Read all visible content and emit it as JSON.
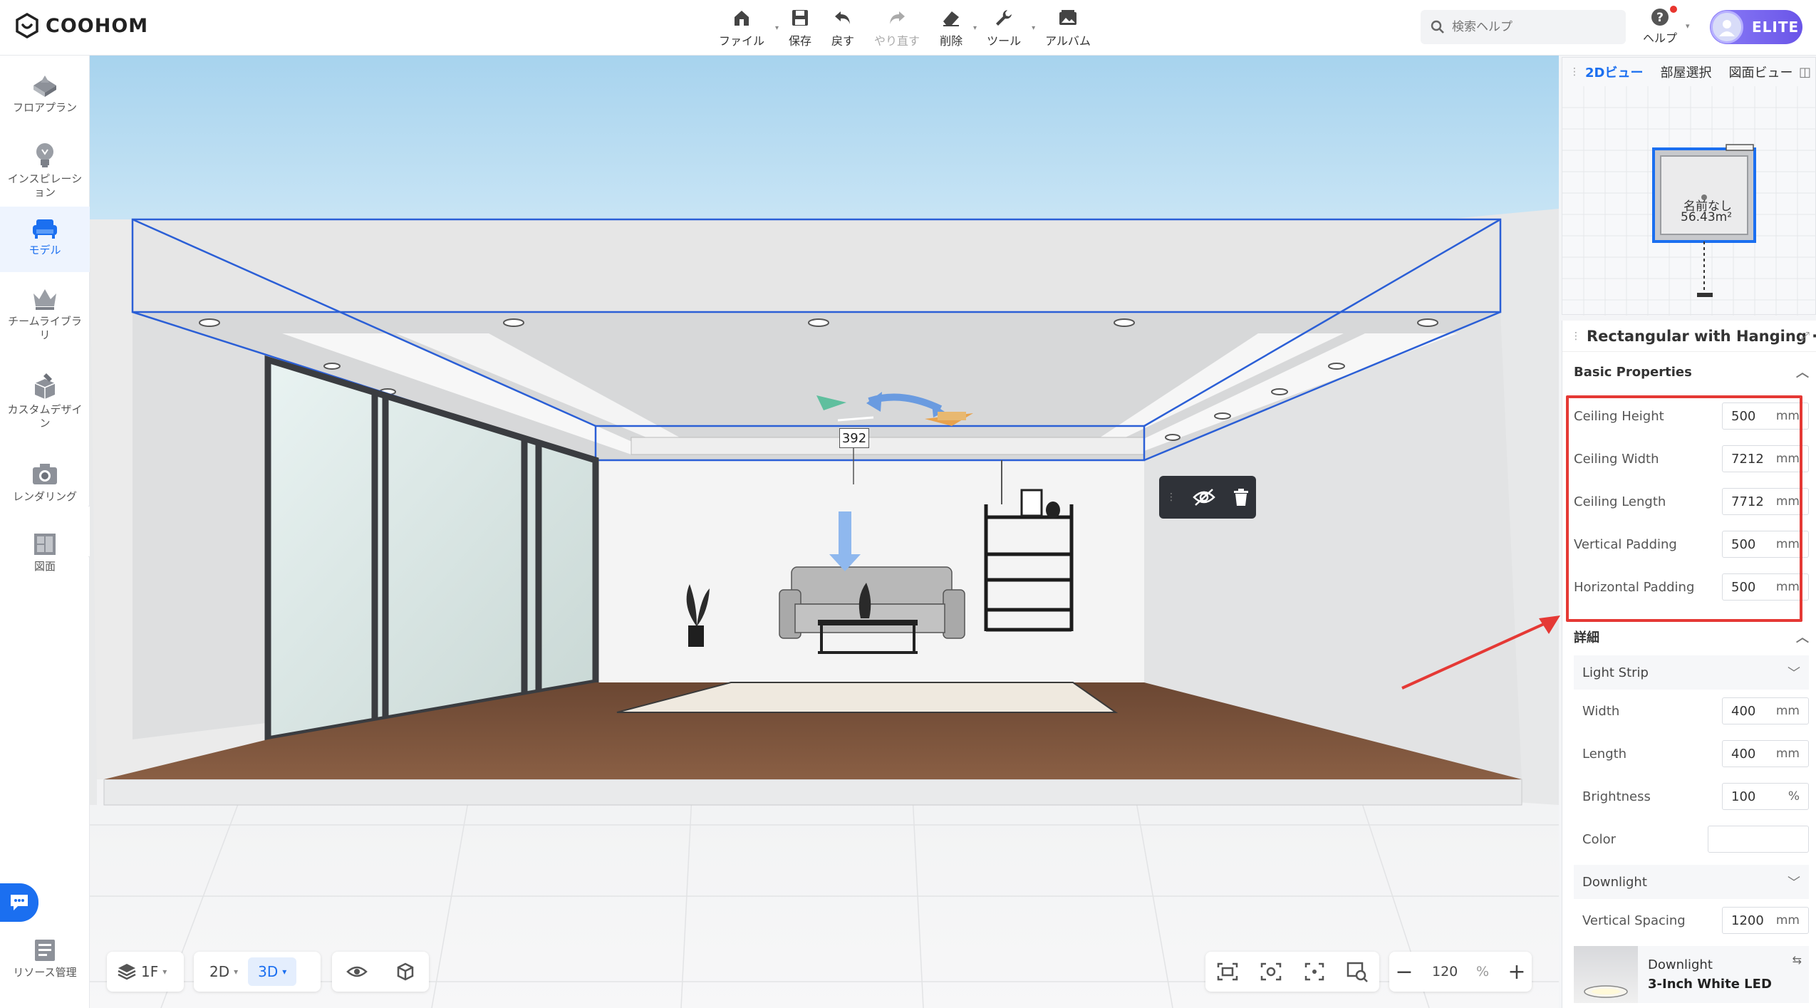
{
  "brand": {
    "name": "COOHOM"
  },
  "toolbar": {
    "file": "ファイル",
    "save": "保存",
    "undo": "戻す",
    "redo": "やり直す",
    "delete": "削除",
    "tools": "ツール",
    "album": "アルバム"
  },
  "search": {
    "placeholder": "検索ヘルプ"
  },
  "help": {
    "label": "ヘルプ"
  },
  "account": {
    "badge": "ELITE"
  },
  "sidebar": {
    "items": [
      {
        "label": "フロアプラン",
        "icon": "floorplan-icon"
      },
      {
        "label": "インスピレーション",
        "icon": "lightbulb-icon"
      },
      {
        "label": "モデル",
        "icon": "sofa-icon",
        "active": true
      },
      {
        "label": "チームライブラリ",
        "icon": "crown-icon"
      },
      {
        "label": "カスタムデザイン",
        "icon": "custom-design-icon"
      },
      {
        "label": "レンダリング",
        "icon": "camera-icon"
      },
      {
        "label": "図面",
        "icon": "drawing-icon"
      }
    ],
    "resource": "リソース管理"
  },
  "viewport": {
    "dimension": "392"
  },
  "bottom": {
    "floor": "1F",
    "view2d": "2D",
    "view3d": "3D",
    "zoom": "120",
    "zoom_unit": "%"
  },
  "minimap": {
    "tabs": [
      "2Dビュー",
      "部屋選択",
      "図面ビュー"
    ],
    "room_name": "名前なし",
    "room_area": "56.43m²"
  },
  "panel": {
    "title": "Rectangular with Hanging ···",
    "basic_section": "Basic Properties",
    "basic": [
      {
        "label": "Ceiling Height",
        "value": "500",
        "unit": "mm"
      },
      {
        "label": "Ceiling Width",
        "value": "7212",
        "unit": "mm"
      },
      {
        "label": "Ceiling Length",
        "value": "7712",
        "unit": "mm"
      },
      {
        "label": "Vertical Padding",
        "value": "500",
        "unit": "mm"
      },
      {
        "label": "Horizontal Padding",
        "value": "500",
        "unit": "mm"
      }
    ],
    "detail_section": "詳細",
    "light_strip": "Light Strip",
    "strip": [
      {
        "label": "Width",
        "value": "400",
        "unit": "mm"
      },
      {
        "label": "Length",
        "value": "400",
        "unit": "mm"
      },
      {
        "label": "Brightness",
        "value": "100",
        "unit": "%"
      }
    ],
    "color_label": "Color",
    "downlight": "Downlight",
    "vertical_spacing": {
      "label": "Vertical Spacing",
      "value": "1200",
      "unit": "mm"
    },
    "card": {
      "name": "Downlight",
      "product": "3-Inch White LED"
    }
  },
  "colors": {
    "accent": "#1b6ff0",
    "highlight": "#e53935",
    "elite": "#7a66f0"
  }
}
